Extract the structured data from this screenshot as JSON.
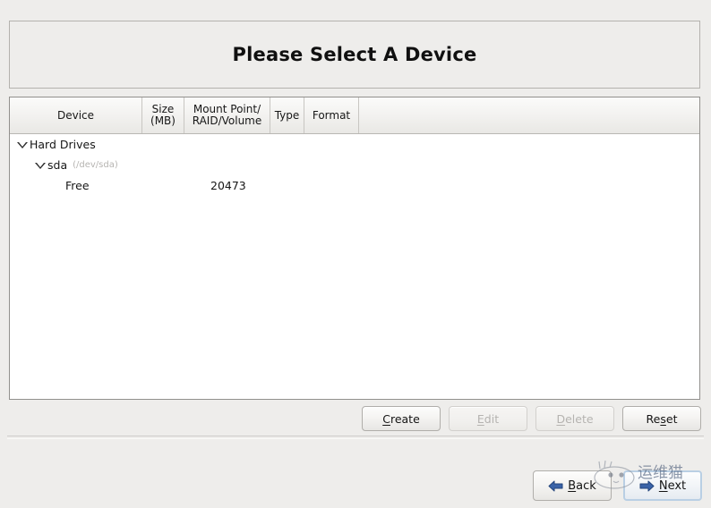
{
  "dialog": {
    "title": "Please Select A Device"
  },
  "table": {
    "columns": [
      {
        "label": "Device",
        "name": "device"
      },
      {
        "label": "Size\n(MB)",
        "name": "size-mb"
      },
      {
        "label": "Mount Point/\nRAID/Volume",
        "name": "mount-point-raid-volume"
      },
      {
        "label": "Type",
        "name": "type"
      },
      {
        "label": "Format",
        "name": "format"
      }
    ],
    "rows": [
      {
        "label": "Hard Drives",
        "sub": "",
        "size": "",
        "indent": 1,
        "expander": "expanded"
      },
      {
        "label": "sda",
        "sub": "(/dev/sda)",
        "size": "",
        "indent": 2,
        "expander": "expanded"
      },
      {
        "label": "Free",
        "sub": "",
        "size": "20473",
        "indent": 3,
        "expander": "none"
      }
    ]
  },
  "actions": {
    "create": {
      "pre": "",
      "acc": "C",
      "post": "reate"
    },
    "edit": {
      "pre": "",
      "acc": "E",
      "post": "dit"
    },
    "delete": {
      "pre": "",
      "acc": "D",
      "post": "elete"
    },
    "reset": {
      "pre": "Re",
      "acc": "s",
      "post": "et"
    }
  },
  "nav": {
    "back": {
      "pre": "",
      "acc": "B",
      "post": "ack"
    },
    "next": {
      "pre": "",
      "acc": "N",
      "post": "ext"
    }
  },
  "watermark": {
    "text": "运维猫"
  },
  "colors": {
    "window_bg": "#eeedeb",
    "list_bg": "#ffffff",
    "border": "#92908d",
    "accent_blue": "#3a6ea5",
    "disabled_text": "#b5b3b0"
  }
}
